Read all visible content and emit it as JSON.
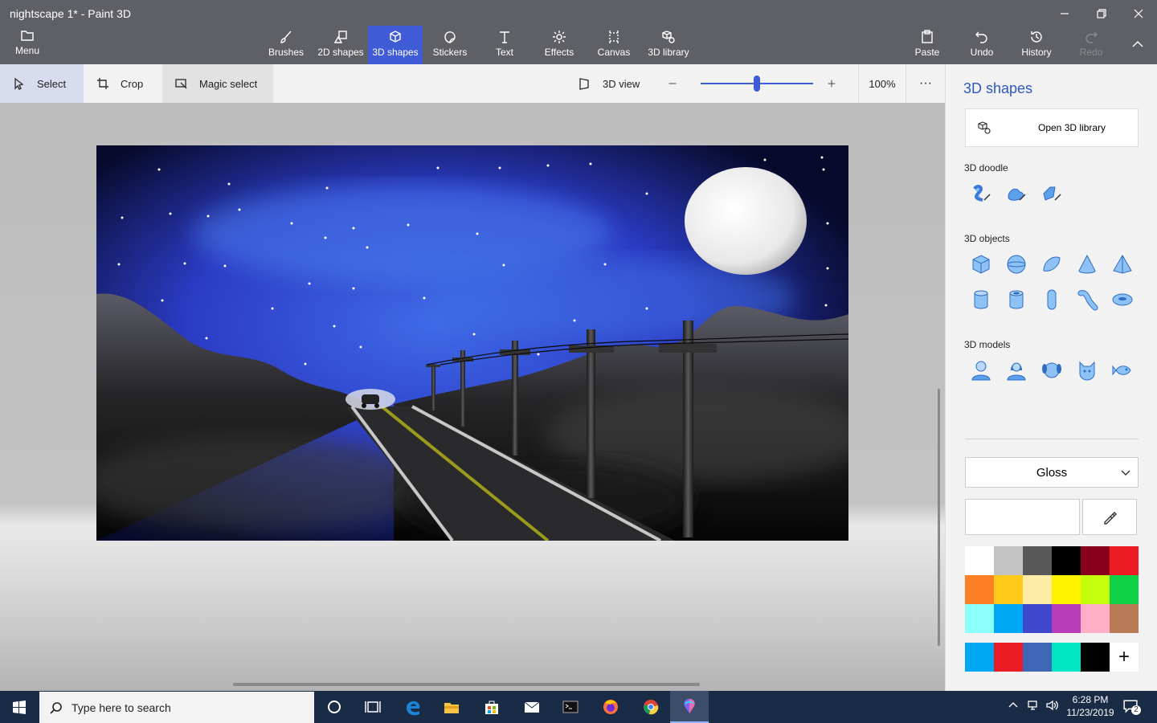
{
  "window": {
    "title": "nightscape 1* - Paint 3D"
  },
  "menu": {
    "label": "Menu"
  },
  "toolbar": {
    "tools": [
      "Brushes",
      "2D shapes",
      "3D shapes",
      "Stickers",
      "Text",
      "Effects",
      "Canvas",
      "3D library"
    ],
    "active_tool": "3D shapes",
    "right_tools": [
      "Paste",
      "Undo",
      "History",
      "Redo"
    ],
    "disabled_tools": [
      "Redo"
    ]
  },
  "subbar": {
    "select": "Select",
    "crop": "Crop",
    "magic_select": "Magic select",
    "view3d": "3D view",
    "zoom_level": "100%",
    "zoom_fraction": 0.5,
    "more": "···"
  },
  "panel": {
    "title": "3D shapes",
    "open_library": "Open 3D library",
    "doodle_heading": "3D doodle",
    "doodle_icons": [
      "sharp-edge-doodle-icon",
      "soft-edge-doodle-icon",
      "tube-doodle-icon"
    ],
    "objects_heading": "3D objects",
    "object_icons": [
      "cube-icon",
      "sphere-icon",
      "hemisphere-icon",
      "cone-icon",
      "pyramid-icon",
      "cylinder-icon",
      "tube-icon",
      "capsule-icon",
      "curved-tube-icon",
      "donut-icon"
    ],
    "models_heading": "3D models",
    "model_icons": [
      "man-icon",
      "woman-icon",
      "dog-icon",
      "cat-icon",
      "fish-icon"
    ],
    "material": "Gloss",
    "palette": [
      "#ffffff",
      "#c3c3c3",
      "#585858",
      "#000000",
      "#88001b",
      "#ec1c24",
      "#ff7f27",
      "#ffca18",
      "#fdeca6",
      "#fff200",
      "#c4ff0e",
      "#0ed145",
      "#8cfffb",
      "#00a8f3",
      "#3f48cc",
      "#b83dba",
      "#ffaec8",
      "#b97a56"
    ],
    "custom_colors": [
      "#00a8f3",
      "#ec1c24",
      "#3f67b8",
      "#00e5c2",
      "#000000"
    ],
    "add_color": "+"
  },
  "accent_color": "#3f5bd6",
  "taskbar": {
    "search_placeholder": "Type here to search",
    "time": "6:28 PM",
    "date": "11/23/2019",
    "notification_count": "2"
  }
}
